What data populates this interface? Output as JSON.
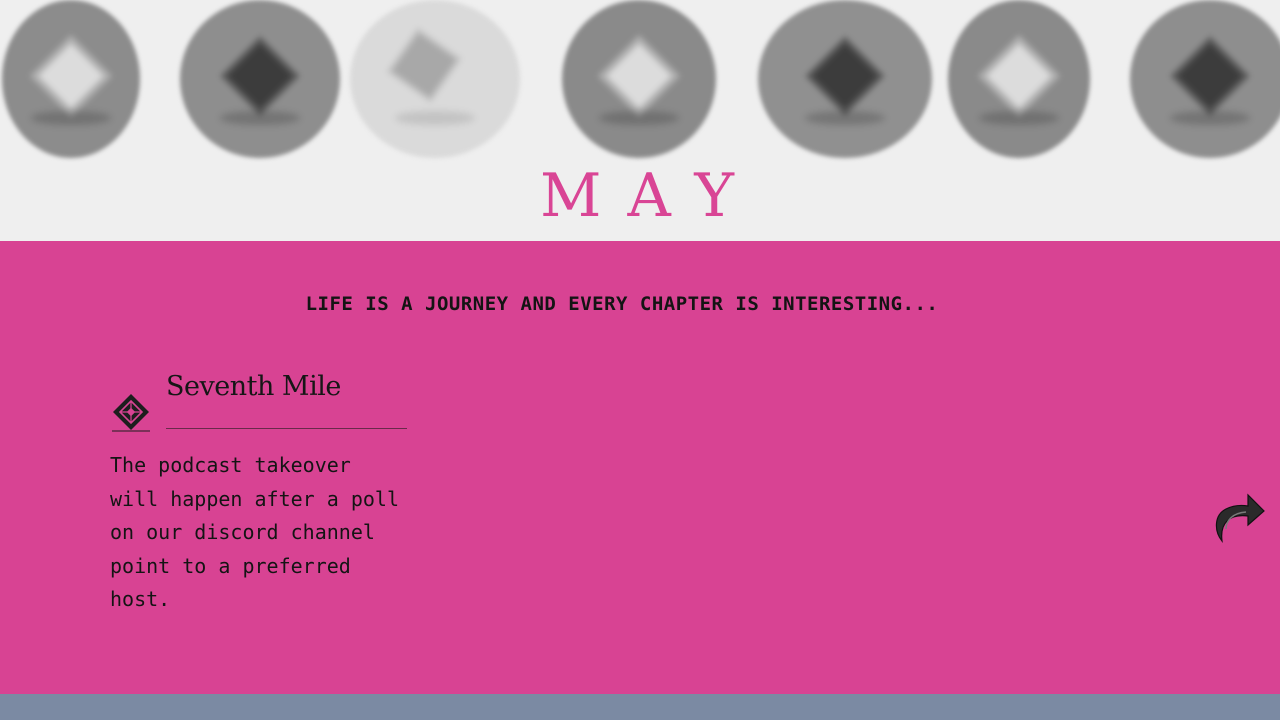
{
  "header": {
    "month": "MAY",
    "gallery_icons": [
      "badge-light-icon",
      "badge-dark-icon",
      "badge-faded-icon",
      "badge-light-icon",
      "badge-dark-icon",
      "badge-light-icon",
      "badge-dark-icon"
    ]
  },
  "main": {
    "tagline": "LIFE IS A JOURNEY AND EVERY CHAPTER IS INTERESTING...",
    "brand": {
      "name": "Seventh Mile",
      "logo_icon": "seventh-mile-logo-icon"
    },
    "body": "The podcast takeover will happen after a poll on our discord channel point to a preferred host.",
    "next_icon": "curved-arrow-right-icon"
  },
  "colors": {
    "accent": "#d94595",
    "panel": "#d84393",
    "background": "#efefef",
    "footer": "#7b8aa3",
    "text": "#141414"
  }
}
